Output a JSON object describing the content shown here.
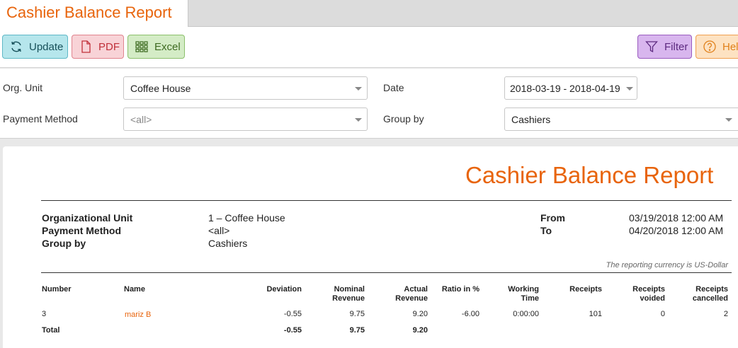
{
  "tab": {
    "title": "Cashier Balance Report"
  },
  "toolbar": {
    "update": "Update",
    "pdf": "PDF",
    "excel": "Excel",
    "filter": "Filter",
    "help": "Help"
  },
  "filters": {
    "org_unit_label": "Org. Unit",
    "org_unit_value": "Coffee House",
    "payment_method_label": "Payment Method",
    "payment_method_value": "<all>",
    "date_label": "Date",
    "date_value": "2018-03-19 - 2018-04-19",
    "group_by_label": "Group by",
    "group_by_value": "Cashiers"
  },
  "report": {
    "title": "Cashier Balance Report",
    "org_unit_label": "Organizational Unit",
    "org_unit_value": "1 – Coffee House",
    "payment_method_label": "Payment Method",
    "payment_method_value": "<all>",
    "group_by_label": "Group by",
    "group_by_value": "Cashiers",
    "from_label": "From",
    "from_value": "03/19/2018 12:00 AM",
    "to_label": "To",
    "to_value": "04/20/2018 12:00 AM",
    "currency_note": "The reporting currency is US-Dollar",
    "columns": [
      {
        "line1": "Number",
        "line2": ""
      },
      {
        "line1": "Name",
        "line2": ""
      },
      {
        "line1": "Deviation",
        "line2": ""
      },
      {
        "line1": "Nominal",
        "line2": "Revenue"
      },
      {
        "line1": "Actual",
        "line2": "Revenue"
      },
      {
        "line1": "Ratio in %",
        "line2": ""
      },
      {
        "line1": "Working",
        "line2": "Time"
      },
      {
        "line1": "Receipts",
        "line2": ""
      },
      {
        "line1": "Receipts",
        "line2": "voided"
      },
      {
        "line1": "Receipts",
        "line2": "cancelled"
      }
    ],
    "rows": [
      {
        "number": "3",
        "name": "mariz B",
        "deviation": "-0.55",
        "nominal_revenue": "9.75",
        "actual_revenue": "9.20",
        "ratio": "-6.00",
        "working_time": "0:00:00",
        "receipts": "101",
        "receipts_voided": "0",
        "receipts_cancelled": "2"
      }
    ],
    "total": {
      "label": "Total",
      "deviation": "-0.55",
      "nominal_revenue": "9.75",
      "actual_revenue": "9.20"
    }
  },
  "colors": {
    "accent": "#e8640c"
  }
}
